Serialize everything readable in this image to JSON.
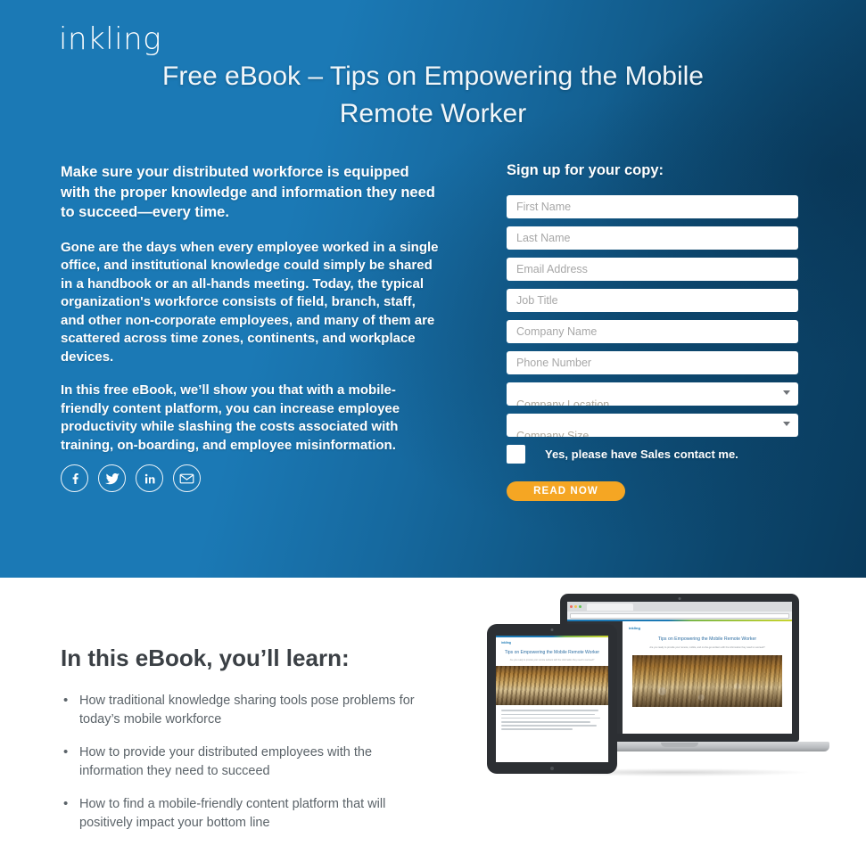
{
  "brand": {
    "logo_text": "inkling",
    "accent_blue": "#1b79b5",
    "accent_orange": "#f5a623",
    "dark_blue": "#093a5c"
  },
  "hero": {
    "title": "Free eBook – Tips on Empowering the Mobile Remote Worker",
    "lead": "Make sure your distributed workforce is equipped with the proper knowledge and information they need to succeed—every time.",
    "paragraph_2": "Gone are the days when every employee worked in a single office, and institutional knowledge could simply be shared in a handbook or an all-hands meeting. Today, the typical organization's workforce consists of field, branch, staff, and other non-corporate employees, and many of them are scattered across time zones, continents, and workplace devices.",
    "paragraph_3": "In this free eBook, we’ll show you that with a mobile-friendly content platform, you can increase employee productivity while slashing the costs associated with training, on-boarding, and employee misinformation.",
    "social": [
      {
        "name": "facebook-icon",
        "label": "Facebook"
      },
      {
        "name": "twitter-icon",
        "label": "Twitter"
      },
      {
        "name": "linkedin-icon",
        "label": "LinkedIn"
      },
      {
        "name": "email-icon",
        "label": "Email"
      }
    ]
  },
  "form": {
    "heading": "Sign up for your copy:",
    "fields": [
      {
        "name": "first-name",
        "placeholder": "First Name",
        "value": ""
      },
      {
        "name": "last-name",
        "placeholder": "Last Name",
        "value": ""
      },
      {
        "name": "email-address",
        "placeholder": "Email Address",
        "value": ""
      },
      {
        "name": "job-title",
        "placeholder": "Job Title",
        "value": ""
      },
      {
        "name": "company-name",
        "placeholder": "Company Name",
        "value": ""
      },
      {
        "name": "phone-number",
        "placeholder": "Phone Number",
        "value": ""
      }
    ],
    "selects": [
      {
        "name": "company-location",
        "value": "Company Location"
      },
      {
        "name": "company-size",
        "value": "Company Size"
      }
    ],
    "checkbox_label": "Yes, please have Sales contact me.",
    "checkbox_checked": false,
    "submit_label": "READ NOW"
  },
  "learn": {
    "title": "In this eBook, you’ll learn:",
    "bullets": [
      "How traditional knowledge sharing tools pose problems for today’s mobile workforce",
      "How to provide your distributed employees with the information they need to succeed",
      "How to find a mobile-friendly content platform that will positively impact your bottom line"
    ]
  },
  "mockup": {
    "laptop": {
      "logo": "inkling",
      "title": "Tips on Empowering the  Mobile Remote Worker",
      "subtitle": "Are you ready to provide your remote, mobile, and on-the-go workers with the information they need to succeed?"
    },
    "tablet": {
      "logo": "inkling",
      "title": "Tips on Empowering the Mobile Remote Worker",
      "subtitle": "Are you ready to provide your remote workers with the information they need to succeed?"
    }
  }
}
